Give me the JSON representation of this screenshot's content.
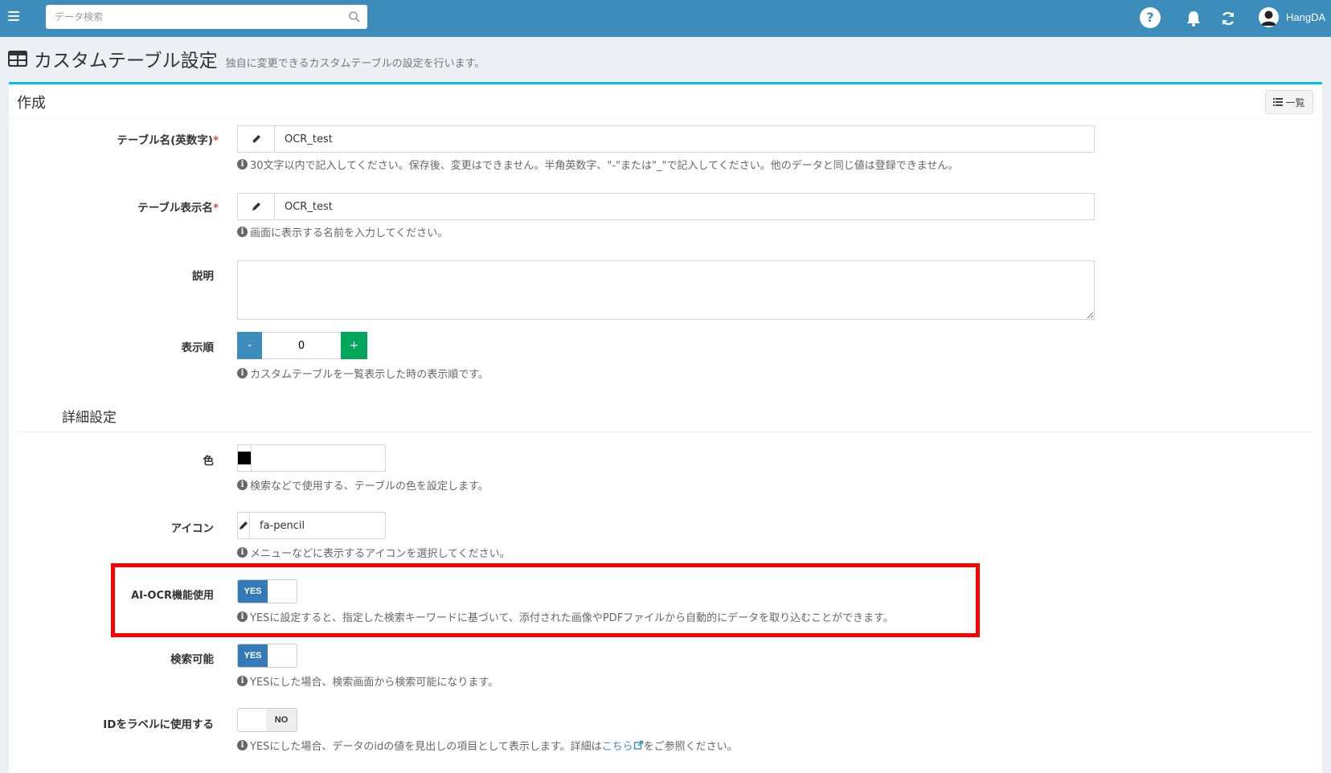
{
  "navbar": {
    "search_placeholder": "データ検索",
    "user_name": "HangDA",
    "help_label": "?"
  },
  "page": {
    "title": "カスタムテーブル設定",
    "subtitle": "独自に変更できるカスタムテーブルの設定を行います。"
  },
  "box": {
    "title": "作成",
    "list_button_label": "一覧"
  },
  "form": {
    "table_name": {
      "label": "テーブル名(英数字)",
      "required_mark": "*",
      "value": "OCR_test",
      "help": "30文字以内で記入してください。保存後、変更はできません。半角英数字、\"-\"または\"_\"で記入してください。他のデータと同じ値は登録できません。"
    },
    "table_view_name": {
      "label": "テーブル表示名",
      "required_mark": "*",
      "value": "OCR_test",
      "help": "画面に表示する名前を入力してください。"
    },
    "description": {
      "label": "説明",
      "value": ""
    },
    "order": {
      "label": "表示順",
      "minus": "-",
      "value": "0",
      "plus": "+",
      "help": "カスタムテーブルを一覧表示した時の表示順です。"
    },
    "detail_section_title": "詳細設定",
    "color": {
      "label": "色",
      "swatch_color": "#000000",
      "value": "",
      "help": "検索などで使用する、テーブルの色を設定します。"
    },
    "icon": {
      "label": "アイコン",
      "value": "fa-pencil",
      "help": "メニューなどに表示するアイコンを選択してください。"
    },
    "ai_ocr": {
      "label": "AI-OCR機能使用",
      "state": "YES",
      "help": "YESに設定すると、指定した検索キーワードに基づいて、添付された画像やPDFファイルから自動的にデータを取り込むことができます。"
    },
    "searchable": {
      "label": "検索可能",
      "state": "YES",
      "help": "YESにした場合、検索画面から検索可能になります。"
    },
    "use_label_id": {
      "label": "IDをラベルに使用する",
      "state": "NO",
      "help_before": "YESにした場合、データのidの値を見出しの項目として表示します。詳細は",
      "help_link": "こちら",
      "help_after": "をご参照ください。"
    }
  },
  "colors": {
    "navbar": "#3c8dbc",
    "accent_border": "#00c0ef",
    "toggle_on": "#337ab7",
    "plus_button": "#00a65a",
    "highlight": "#ff0000"
  }
}
